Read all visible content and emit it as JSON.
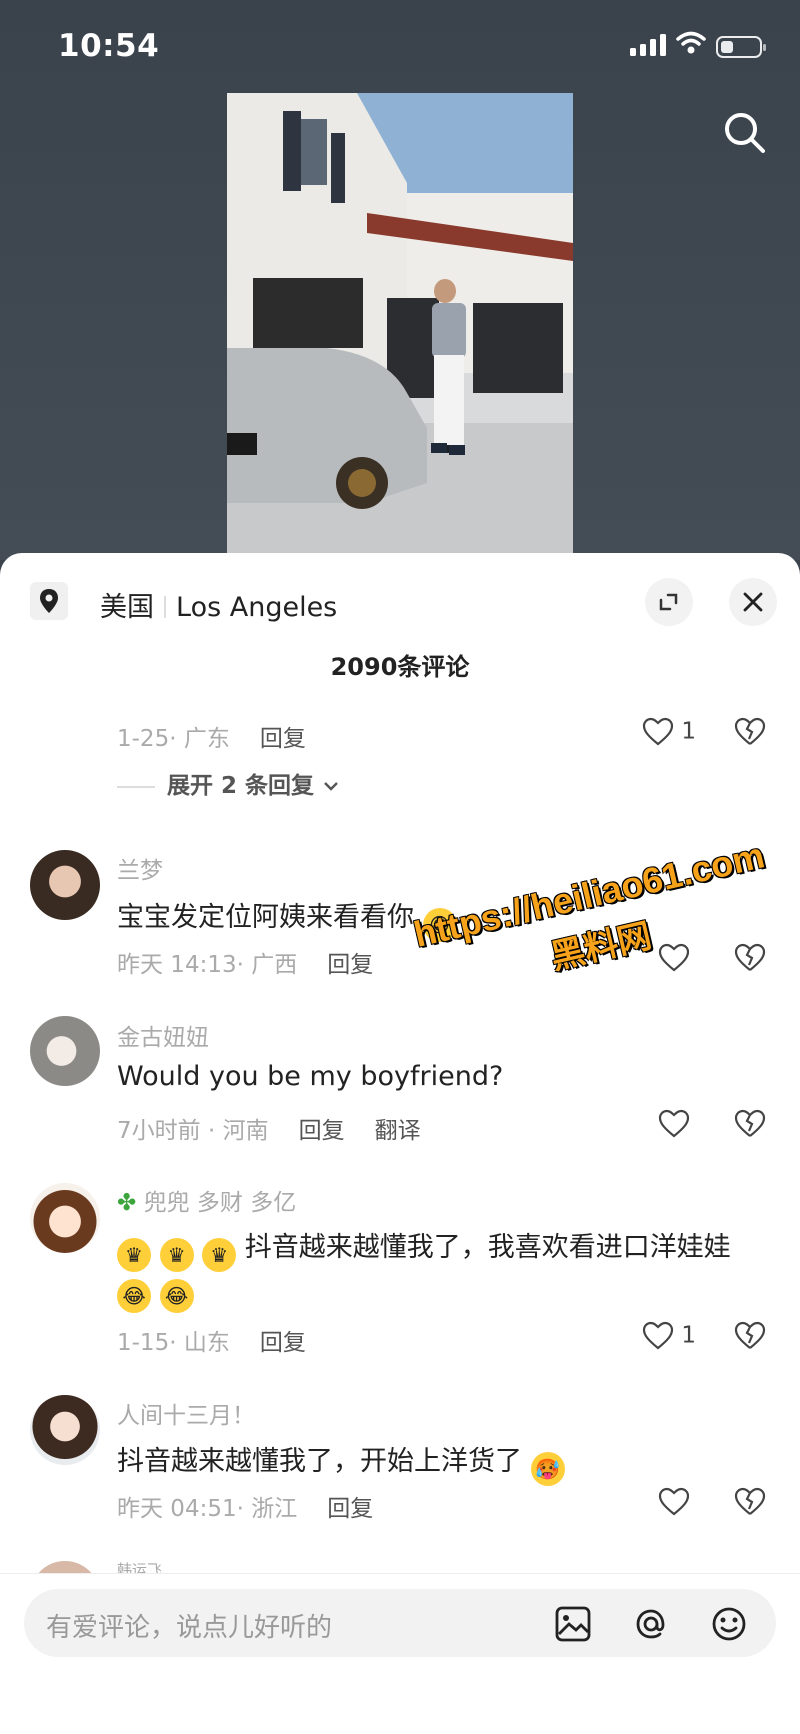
{
  "status_bar": {
    "time": "10:54"
  },
  "location": {
    "country": "美国",
    "city": "Los Angeles"
  },
  "comments_count": "2090条评论",
  "partial_comment": {
    "meta": "1-25· 广东",
    "reply": "回复",
    "likes": "1"
  },
  "expand_replies": "展开 2 条回复",
  "comments": [
    {
      "name": "兰梦",
      "text": "宝宝发定位阿姨来看看你",
      "meta": "昨天 14:13· 广西",
      "reply": "回复",
      "likes": ""
    },
    {
      "name": "金古妞妞",
      "text": "Would you be my boyfriend?",
      "meta": "7小时前 · 河南",
      "reply": "回复",
      "translate": "翻译",
      "likes": ""
    },
    {
      "name": "兜兜 多财 多亿",
      "text": "抖音越来越懂我了，我喜欢看进口洋娃娃",
      "meta": "1-15· 山东",
      "reply": "回复",
      "likes": "1"
    },
    {
      "name": "人间十三月！",
      "text": "抖音越来越懂我了，开始上洋货了",
      "meta": "昨天 04:51· 浙江",
      "reply": "回复",
      "likes": ""
    },
    {
      "name": "韩运飞"
    }
  ],
  "input": {
    "placeholder": "有爱评论，说点儿好听的"
  },
  "watermark": {
    "url": "https://heiliao61.com",
    "site": "黑料网"
  },
  "icons": [
    "location-pin-icon",
    "expand-icon",
    "close-icon",
    "search-icon",
    "heart-icon",
    "broken-heart-icon",
    "image-icon",
    "at-icon",
    "emoji-icon",
    "chevron-down-icon"
  ]
}
